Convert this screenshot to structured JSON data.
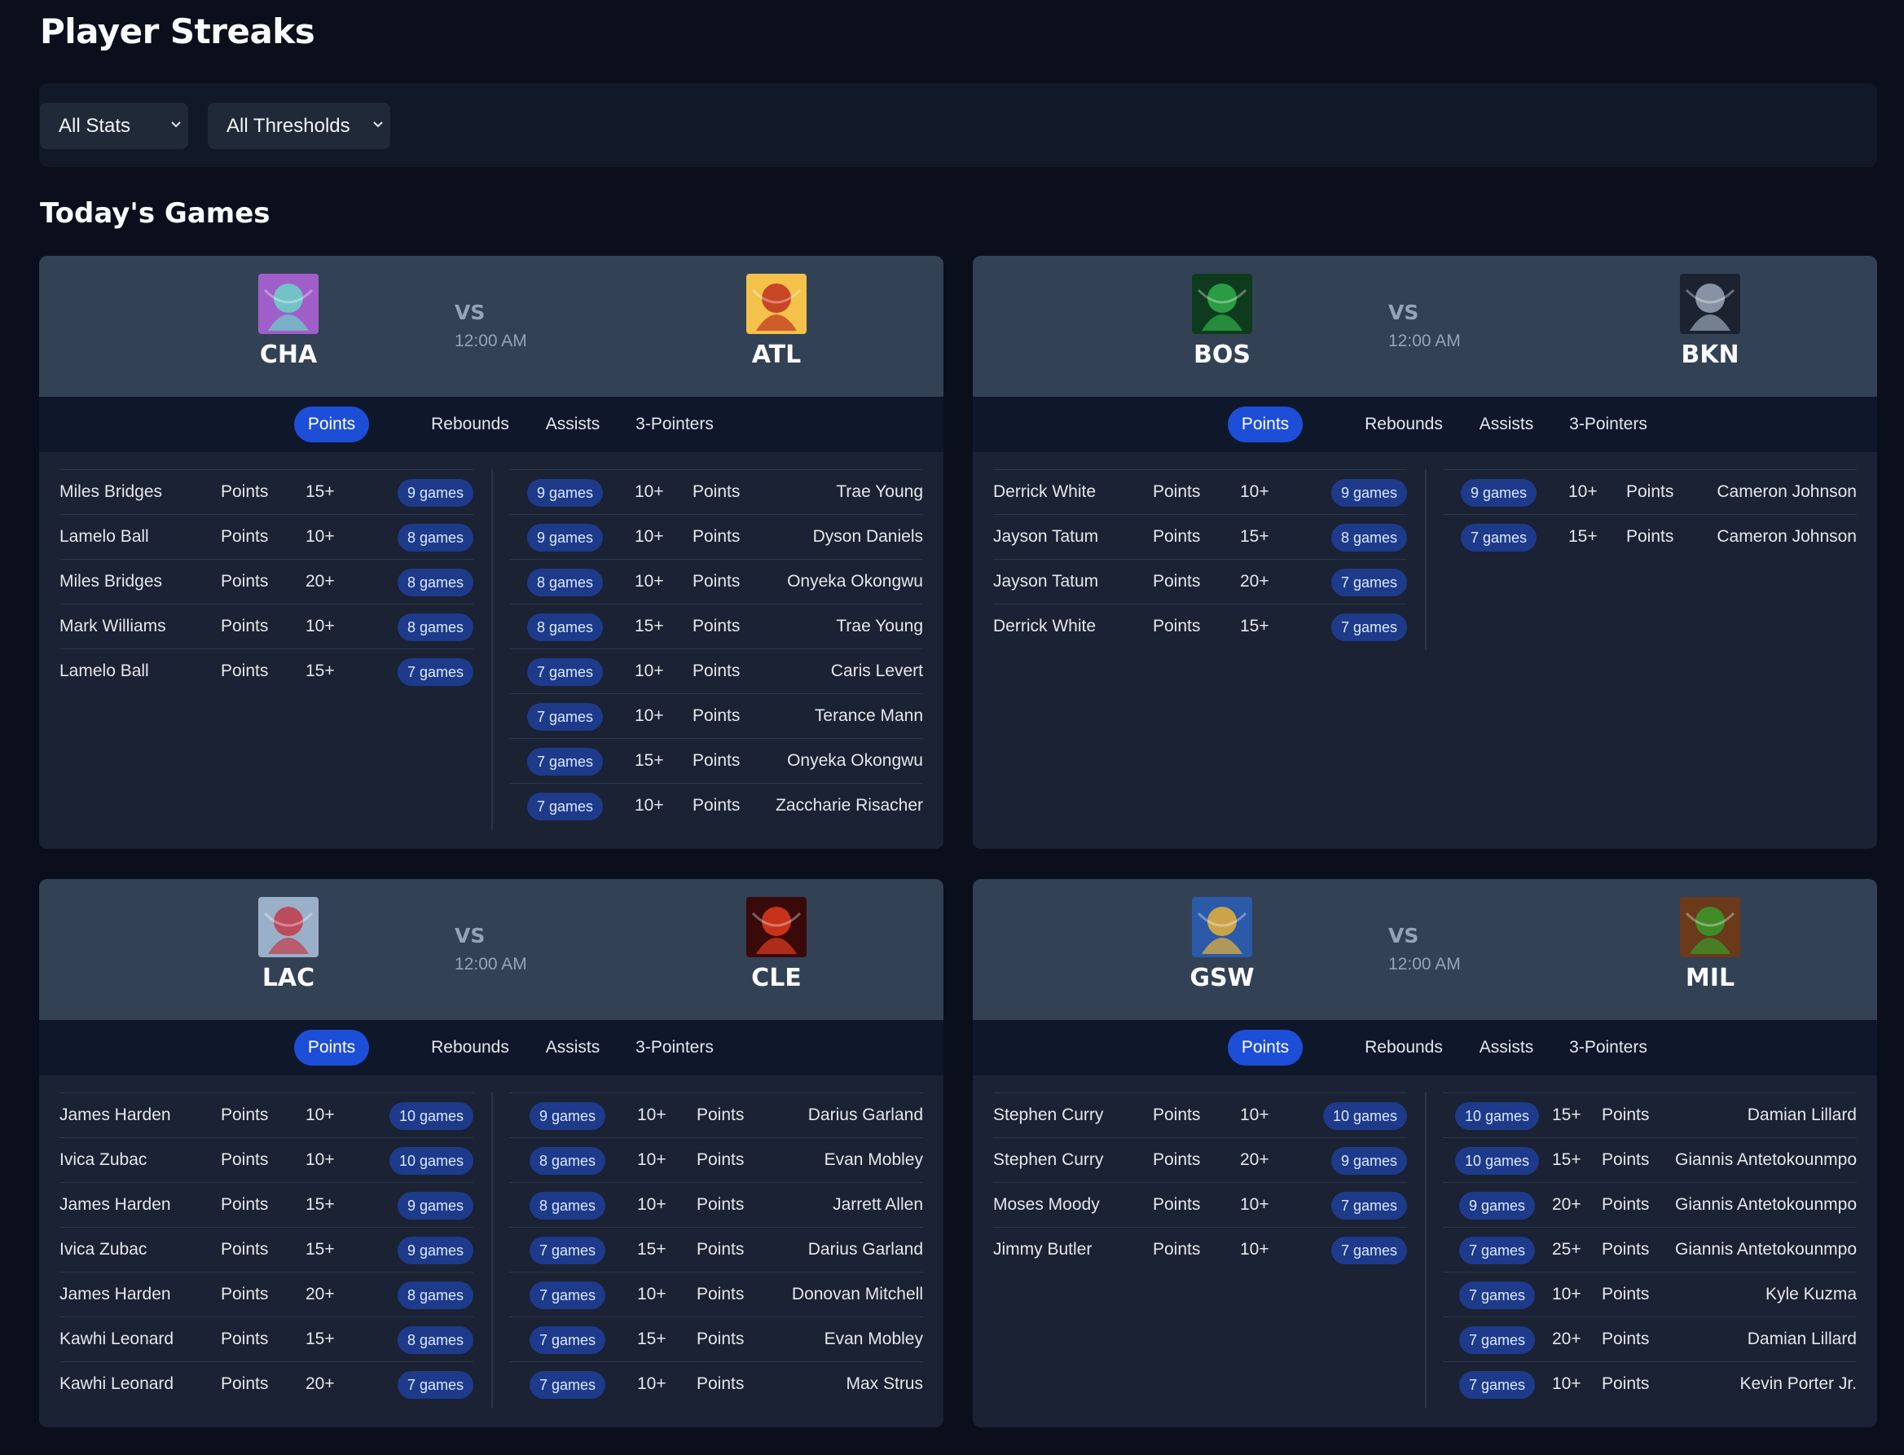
{
  "title": "Player Streaks",
  "filters": {
    "stats": "All Stats",
    "thresholds": "All Thresholds"
  },
  "section_title": "Today's Games",
  "tabs": [
    "Points",
    "Rebounds",
    "Assists",
    "3-Pointers"
  ],
  "vs_label": "VS",
  "games": [
    {
      "home": {
        "abbr": "CHA",
        "logo_icon": "hornet-warrior-icon",
        "logo_colors": [
          "#6ad3c8",
          "#a05fc8"
        ]
      },
      "away": {
        "abbr": "ATL",
        "logo_icon": "phoenix-icon",
        "logo_colors": [
          "#c0301e",
          "#f4c24a"
        ]
      },
      "time": "12:00 AM",
      "left": [
        {
          "player": "Miles Bridges",
          "stat": "Points",
          "threshold": "15+",
          "streak": "9 games"
        },
        {
          "player": "Lamelo Ball",
          "stat": "Points",
          "threshold": "10+",
          "streak": "8 games"
        },
        {
          "player": "Miles Bridges",
          "stat": "Points",
          "threshold": "20+",
          "streak": "8 games"
        },
        {
          "player": "Mark Williams",
          "stat": "Points",
          "threshold": "10+",
          "streak": "8 games"
        },
        {
          "player": "Lamelo Ball",
          "stat": "Points",
          "threshold": "15+",
          "streak": "7 games"
        }
      ],
      "right": [
        {
          "player": "Trae Young",
          "stat": "Points",
          "threshold": "10+",
          "streak": "9 games"
        },
        {
          "player": "Dyson Daniels",
          "stat": "Points",
          "threshold": "10+",
          "streak": "9 games"
        },
        {
          "player": "Onyeka Okongwu",
          "stat": "Points",
          "threshold": "10+",
          "streak": "8 games"
        },
        {
          "player": "Trae Young",
          "stat": "Points",
          "threshold": "15+",
          "streak": "8 games"
        },
        {
          "player": "Caris Levert",
          "stat": "Points",
          "threshold": "10+",
          "streak": "7 games"
        },
        {
          "player": "Terance Mann",
          "stat": "Points",
          "threshold": "10+",
          "streak": "7 games"
        },
        {
          "player": "Onyeka Okongwu",
          "stat": "Points",
          "threshold": "15+",
          "streak": "7 games"
        },
        {
          "player": "Zaccharie Risacher",
          "stat": "Points",
          "threshold": "10+",
          "streak": "7 games"
        }
      ]
    },
    {
      "home": {
        "abbr": "BOS",
        "logo_icon": "green-wizard-icon",
        "logo_colors": [
          "#2fae4a",
          "#0e3b1e"
        ]
      },
      "away": {
        "abbr": "BKN",
        "logo_icon": "dark-knight-icon",
        "logo_colors": [
          "#9aa6b8",
          "#1c2230"
        ]
      },
      "time": "12:00 AM",
      "left": [
        {
          "player": "Derrick White",
          "stat": "Points",
          "threshold": "10+",
          "streak": "9 games"
        },
        {
          "player": "Jayson Tatum",
          "stat": "Points",
          "threshold": "15+",
          "streak": "8 games"
        },
        {
          "player": "Jayson Tatum",
          "stat": "Points",
          "threshold": "20+",
          "streak": "7 games"
        },
        {
          "player": "Derrick White",
          "stat": "Points",
          "threshold": "15+",
          "streak": "7 games"
        }
      ],
      "right": [
        {
          "player": "Cameron Johnson",
          "stat": "Points",
          "threshold": "10+",
          "streak": "9 games"
        },
        {
          "player": "Cameron Johnson",
          "stat": "Points",
          "threshold": "15+",
          "streak": "7 games"
        }
      ]
    },
    {
      "home": {
        "abbr": "LAC",
        "logo_icon": "red-demon-icon",
        "logo_colors": [
          "#c23a4a",
          "#9ab0c8"
        ]
      },
      "away": {
        "abbr": "CLE",
        "logo_icon": "fire-warrior-icon",
        "logo_colors": [
          "#e03a1e",
          "#3a0a0a"
        ]
      },
      "time": "12:00 AM",
      "left": [
        {
          "player": "James Harden",
          "stat": "Points",
          "threshold": "10+",
          "streak": "10 games"
        },
        {
          "player": "Ivica Zubac",
          "stat": "Points",
          "threshold": "10+",
          "streak": "10 games"
        },
        {
          "player": "James Harden",
          "stat": "Points",
          "threshold": "15+",
          "streak": "9 games"
        },
        {
          "player": "Ivica Zubac",
          "stat": "Points",
          "threshold": "15+",
          "streak": "9 games"
        },
        {
          "player": "James Harden",
          "stat": "Points",
          "threshold": "20+",
          "streak": "8 games"
        },
        {
          "player": "Kawhi Leonard",
          "stat": "Points",
          "threshold": "15+",
          "streak": "8 games"
        },
        {
          "player": "Kawhi Leonard",
          "stat": "Points",
          "threshold": "20+",
          "streak": "7 games"
        }
      ],
      "right": [
        {
          "player": "Darius Garland",
          "stat": "Points",
          "threshold": "10+",
          "streak": "9 games"
        },
        {
          "player": "Evan Mobley",
          "stat": "Points",
          "threshold": "10+",
          "streak": "8 games"
        },
        {
          "player": "Jarrett Allen",
          "stat": "Points",
          "threshold": "10+",
          "streak": "8 games"
        },
        {
          "player": "Darius Garland",
          "stat": "Points",
          "threshold": "15+",
          "streak": "7 games"
        },
        {
          "player": "Donovan Mitchell",
          "stat": "Points",
          "threshold": "10+",
          "streak": "7 games"
        },
        {
          "player": "Evan Mobley",
          "stat": "Points",
          "threshold": "15+",
          "streak": "7 games"
        },
        {
          "player": "Max Strus",
          "stat": "Points",
          "threshold": "10+",
          "streak": "7 games"
        }
      ]
    },
    {
      "home": {
        "abbr": "GSW",
        "logo_icon": "golden-knight-icon",
        "logo_colors": [
          "#e8b23a",
          "#2a5aa8"
        ]
      },
      "away": {
        "abbr": "MIL",
        "logo_icon": "antlered-beast-icon",
        "logo_colors": [
          "#3a9a2a",
          "#6a3a1a"
        ]
      },
      "time": "12:00 AM",
      "left": [
        {
          "player": "Stephen Curry",
          "stat": "Points",
          "threshold": "10+",
          "streak": "10 games"
        },
        {
          "player": "Stephen Curry",
          "stat": "Points",
          "threshold": "20+",
          "streak": "9 games"
        },
        {
          "player": "Moses Moody",
          "stat": "Points",
          "threshold": "10+",
          "streak": "7 games"
        },
        {
          "player": "Jimmy Butler",
          "stat": "Points",
          "threshold": "10+",
          "streak": "7 games"
        }
      ],
      "right": [
        {
          "player": "Damian Lillard",
          "stat": "Points",
          "threshold": "15+",
          "streak": "10 games"
        },
        {
          "player": "Giannis Antetokounmpo",
          "stat": "Points",
          "threshold": "15+",
          "streak": "10 games"
        },
        {
          "player": "Giannis Antetokounmpo",
          "stat": "Points",
          "threshold": "20+",
          "streak": "9 games"
        },
        {
          "player": "Giannis Antetokounmpo",
          "stat": "Points",
          "threshold": "25+",
          "streak": "7 games"
        },
        {
          "player": "Kyle Kuzma",
          "stat": "Points",
          "threshold": "10+",
          "streak": "7 games"
        },
        {
          "player": "Damian Lillard",
          "stat": "Points",
          "threshold": "20+",
          "streak": "7 games"
        },
        {
          "player": "Kevin Porter Jr.",
          "stat": "Points",
          "threshold": "10+",
          "streak": "7 games"
        }
      ]
    }
  ],
  "colors": {
    "background": "#0b0f1c",
    "panel": "#111827",
    "card": "#1a2233",
    "card_header": "#334155",
    "tab_active": "#1d4ed8",
    "badge": "#1e3a8a"
  }
}
